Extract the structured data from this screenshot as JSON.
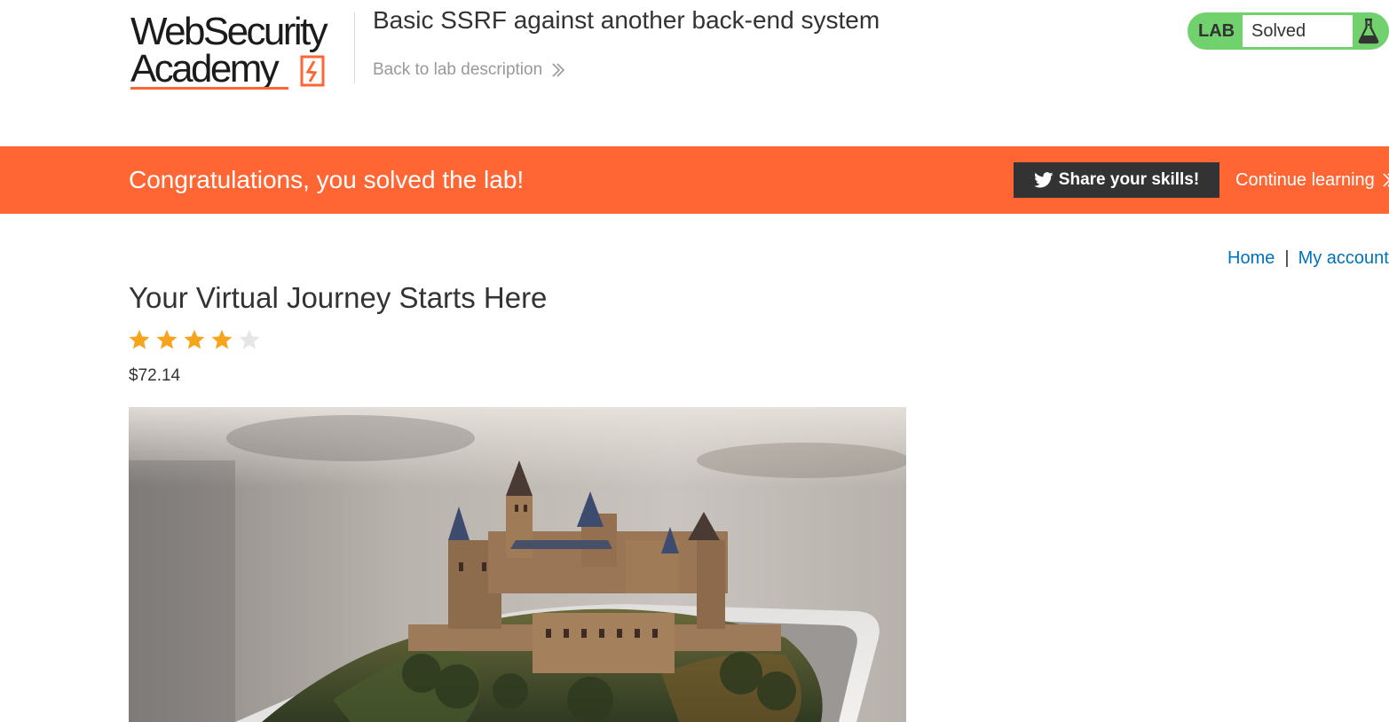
{
  "header": {
    "logo": {
      "line1": "WebSecurity",
      "line2": "Academy"
    },
    "lab_title": "Basic SSRF against another back-end system",
    "back_link": "Back to lab description",
    "lab_status": {
      "tag": "LAB",
      "state": "Solved",
      "icon": "flask-icon"
    }
  },
  "banner": {
    "message": "Congratulations, you solved the lab!",
    "share_button": "Share your skills!",
    "share_icon": "twitter-icon",
    "continue_link": "Continue learning"
  },
  "nav": {
    "home": "Home",
    "separator": "|",
    "my_account": "My account"
  },
  "product": {
    "title": "Your Virtual Journey Starts Here",
    "rating": 4,
    "rating_max": 5,
    "price": "$72.14",
    "image_icon": "castle-on-phone-photo"
  },
  "colors": {
    "accent": "#ff6633",
    "lab_solved": "#70d16d",
    "link": "#0071bc",
    "share_bg": "#333333",
    "star_filled": "#f7a41d",
    "star_empty": "#e6e6e6"
  }
}
